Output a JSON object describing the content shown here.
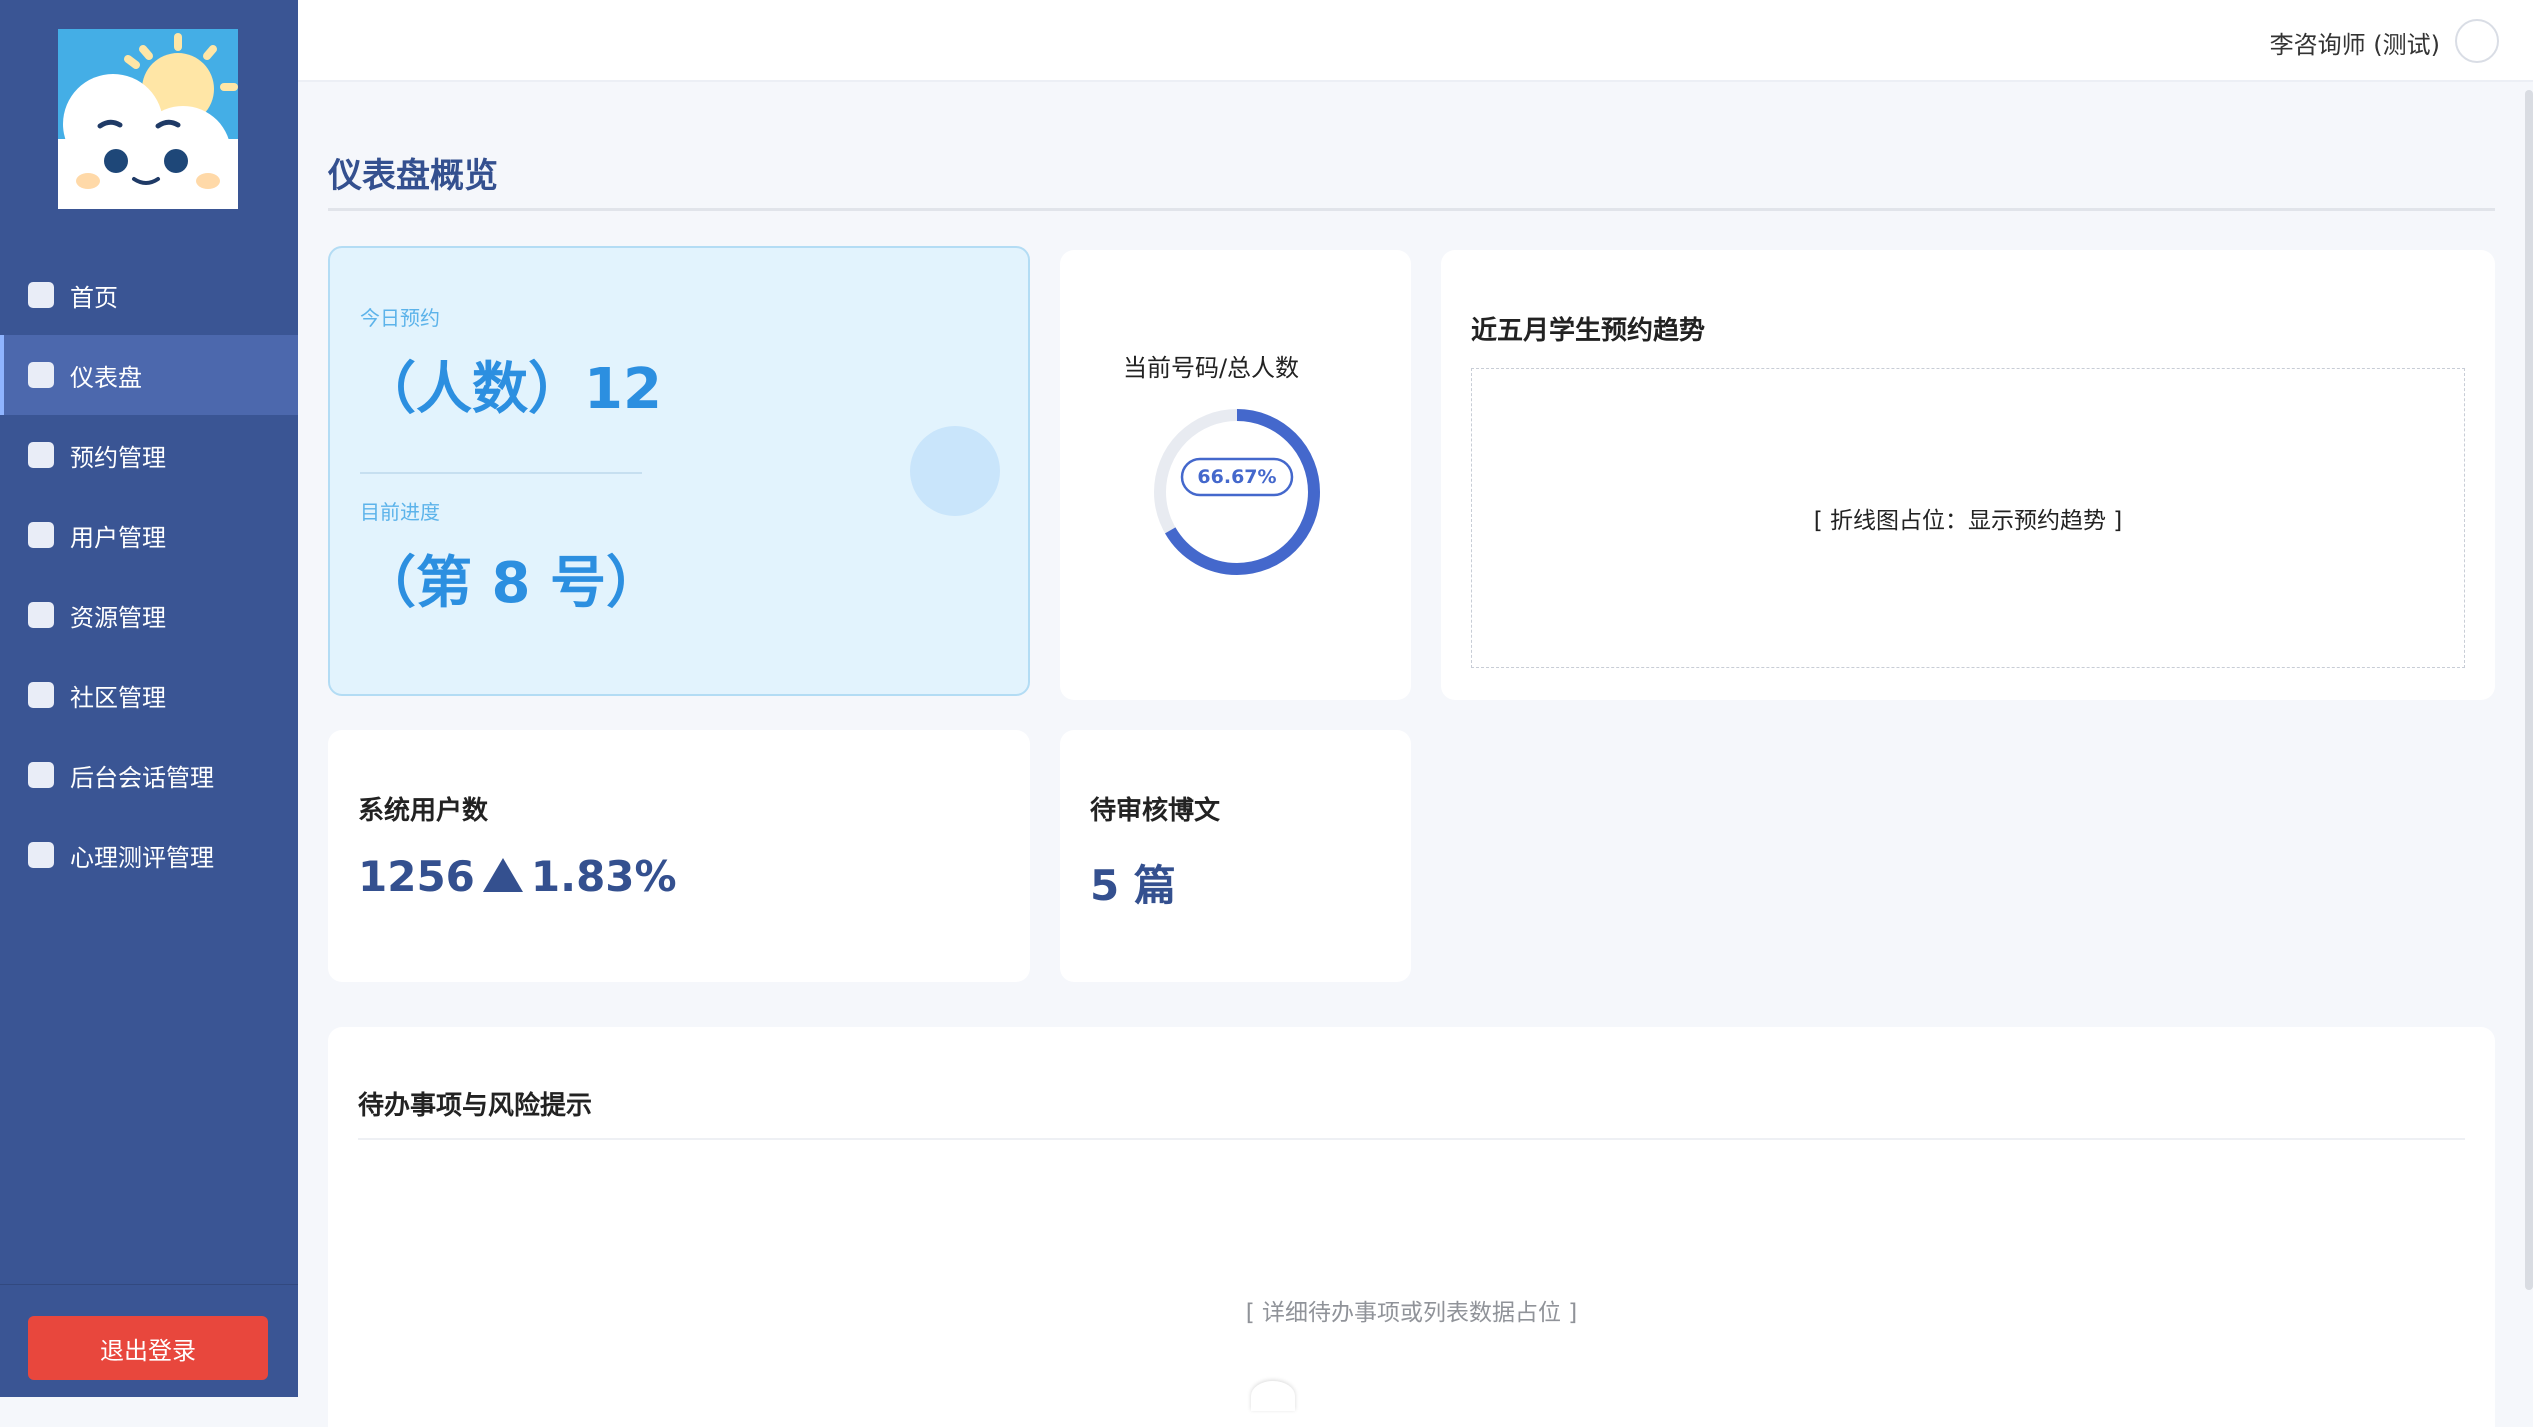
{
  "sidebar": {
    "items": [
      {
        "label": "首页"
      },
      {
        "label": "仪表盘"
      },
      {
        "label": "预约管理"
      },
      {
        "label": "用户管理"
      },
      {
        "label": "资源管理"
      },
      {
        "label": "社区管理"
      },
      {
        "label": "后台会话管理"
      },
      {
        "label": "心理测评管理"
      }
    ],
    "active": "仪表盘",
    "logout_label": "退出登录"
  },
  "header": {
    "user_name": "李咨询师 (测试)"
  },
  "page": {
    "title": "仪表盘概览"
  },
  "booking": {
    "today_label": "今日预约",
    "today_value": "（人数）12",
    "progress_label": "目前进度",
    "progress_value": "（第 8 号）"
  },
  "progress": {
    "title": "当前号码/总人数",
    "percent_label": "66.67%",
    "percent": 66.67
  },
  "trend": {
    "title": "近五月学生预约趋势",
    "placeholder": "[ 折线图占位：显示预约趋势 ]"
  },
  "users": {
    "title": "系统用户数",
    "count": "1256",
    "change": "1.83%"
  },
  "posts": {
    "title": "待审核博文",
    "value": "5 篇"
  },
  "todo": {
    "title": "待办事项与风险提示",
    "placeholder": "[ 详细待办事项或列表数据占位 ]"
  },
  "colors": {
    "sidebar_bg": "#3a5594",
    "sidebar_active": "#4c68ad",
    "accent": "#34508f",
    "booking_blue": "#2c8fe0",
    "ring": "#4468cc",
    "logout": "#e8473d"
  }
}
